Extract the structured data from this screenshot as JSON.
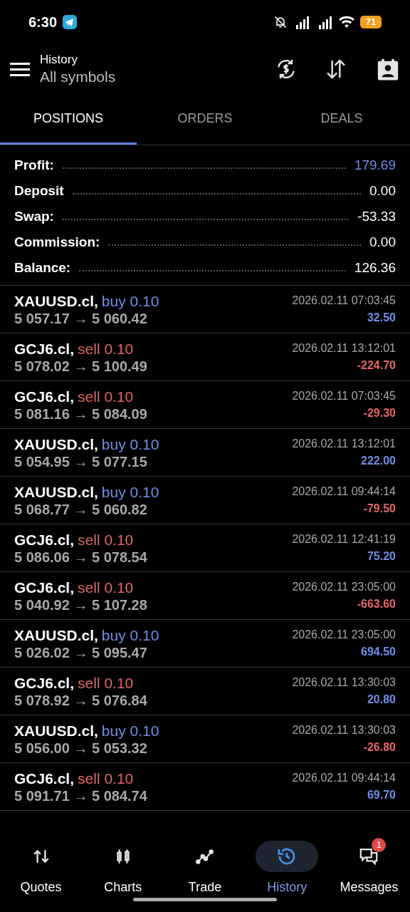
{
  "status_bar": {
    "time": "6:30",
    "battery": "71"
  },
  "header": {
    "title": "History",
    "subtitle": "All symbols"
  },
  "tabs": [
    {
      "label": "POSITIONS",
      "selected": true
    },
    {
      "label": "ORDERS",
      "selected": false
    },
    {
      "label": "DEALS",
      "selected": false
    }
  ],
  "summary": [
    {
      "label": "Profit:",
      "value": "179.69",
      "highlight": true
    },
    {
      "label": "Deposit",
      "value": "0.00",
      "highlight": false
    },
    {
      "label": "Swap:",
      "value": "-53.33",
      "highlight": false
    },
    {
      "label": "Commission:",
      "value": "0.00",
      "highlight": false
    },
    {
      "label": "Balance:",
      "value": "126.36",
      "highlight": false
    }
  ],
  "positions": [
    {
      "symbol": "XAUUSD.cl,",
      "kind": "buy",
      "order": "buy 0.10",
      "prices": "5 057.17 → 5 060.42",
      "time": "2026.02.11 07:03:45",
      "profit": "32.50",
      "loss": false
    },
    {
      "symbol": "GCJ6.cl,",
      "kind": "sell",
      "order": "sell 0.10",
      "prices": "5 078.02 → 5 100.49",
      "time": "2026.02.11 13:12:01",
      "profit": "-224.70",
      "loss": true
    },
    {
      "symbol": "GCJ6.cl,",
      "kind": "sell",
      "order": "sell 0.10",
      "prices": "5 081.16 → 5 084.09",
      "time": "2026.02.11 07:03:45",
      "profit": "-29.30",
      "loss": true
    },
    {
      "symbol": "XAUUSD.cl,",
      "kind": "buy",
      "order": "buy 0.10",
      "prices": "5 054.95 → 5 077.15",
      "time": "2026.02.11 13:12:01",
      "profit": "222.00",
      "loss": false
    },
    {
      "symbol": "XAUUSD.cl,",
      "kind": "buy",
      "order": "buy 0.10",
      "prices": "5 068.77 → 5 060.82",
      "time": "2026.02.11 09:44:14",
      "profit": "-79.50",
      "loss": true
    },
    {
      "symbol": "GCJ6.cl,",
      "kind": "sell",
      "order": "sell 0.10",
      "prices": "5 086.06 → 5 078.54",
      "time": "2026.02.11 12:41:19",
      "profit": "75.20",
      "loss": false
    },
    {
      "symbol": "GCJ6.cl,",
      "kind": "sell",
      "order": "sell 0.10",
      "prices": "5 040.92 → 5 107.28",
      "time": "2026.02.11 23:05:00",
      "profit": "-663.60",
      "loss": true
    },
    {
      "symbol": "XAUUSD.cl,",
      "kind": "buy",
      "order": "buy 0.10",
      "prices": "5 026.02 → 5 095.47",
      "time": "2026.02.11 23:05:00",
      "profit": "694.50",
      "loss": false
    },
    {
      "symbol": "GCJ6.cl,",
      "kind": "sell",
      "order": "sell 0.10",
      "prices": "5 078.92 → 5 076.84",
      "time": "2026.02.11 13:30:03",
      "profit": "20.80",
      "loss": false
    },
    {
      "symbol": "XAUUSD.cl,",
      "kind": "buy",
      "order": "buy 0.10",
      "prices": "5 056.00 → 5 053.32",
      "time": "2026.02.11 13:30:03",
      "profit": "-26.80",
      "loss": true
    },
    {
      "symbol": "GCJ6.cl,",
      "kind": "sell",
      "order": "sell 0.10",
      "prices": "5 091.71 → 5 084.74",
      "time": "2026.02.11 09:44:14",
      "profit": "69.70",
      "loss": false
    }
  ],
  "bottom_nav": [
    {
      "kind": "quotes",
      "label": "Quotes",
      "selected": false
    },
    {
      "kind": "charts",
      "label": "Charts",
      "selected": false
    },
    {
      "kind": "trade",
      "label": "Trade",
      "selected": false
    },
    {
      "kind": "history",
      "label": "History",
      "selected": true
    },
    {
      "kind": "messages",
      "label": "Messages",
      "selected": false,
      "badge": "1"
    }
  ]
}
